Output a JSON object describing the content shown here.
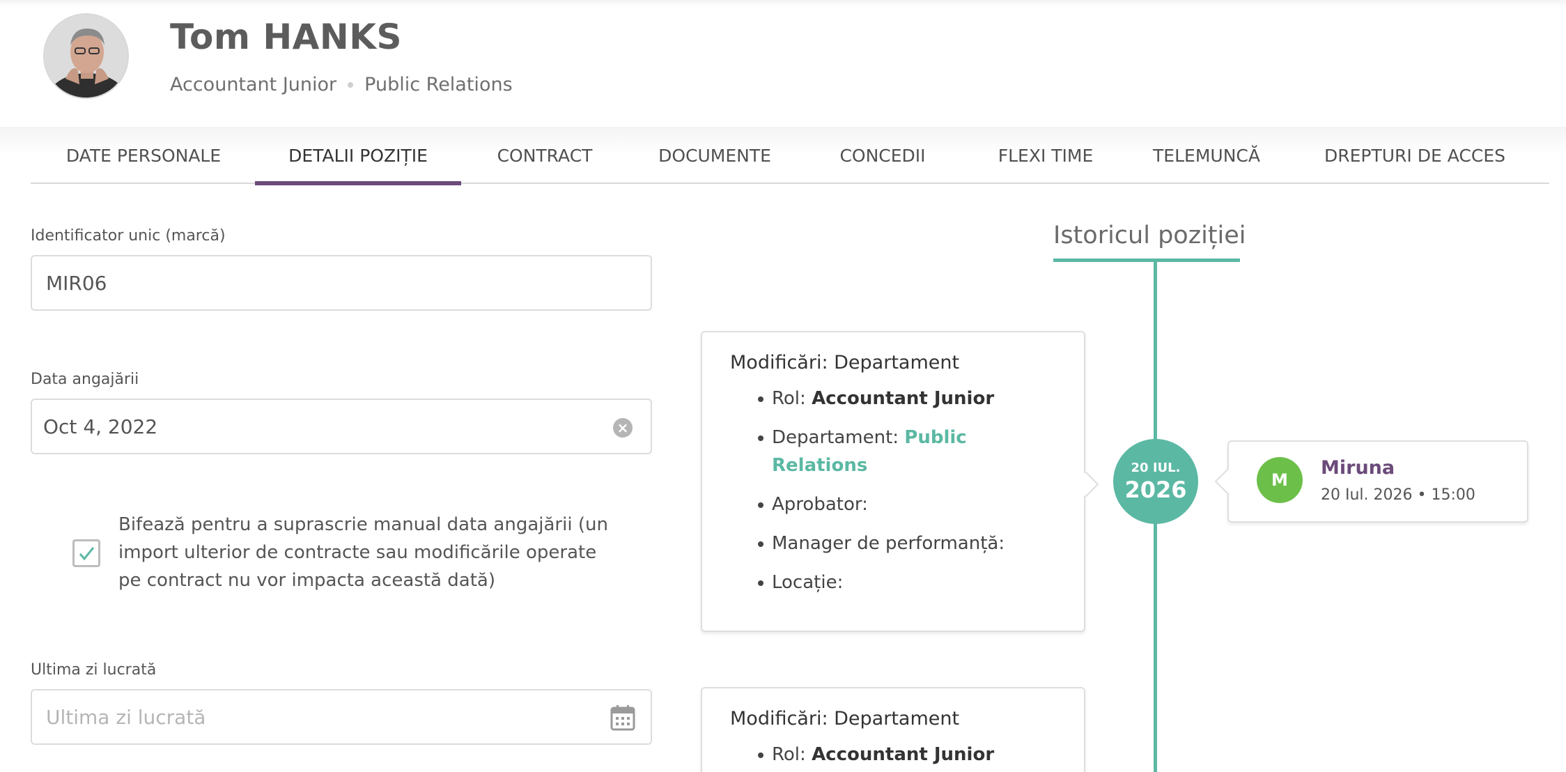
{
  "header": {
    "name": "Tom HANKS",
    "role": "Accountant Junior",
    "department": "Public Relations"
  },
  "tabs": [
    {
      "label": "DATE PERSONALE"
    },
    {
      "label": "DETALII POZIȚIE"
    },
    {
      "label": "CONTRACT"
    },
    {
      "label": "DOCUMENTE"
    },
    {
      "label": "CONCEDII"
    },
    {
      "label": "FLEXI TIME"
    },
    {
      "label": "TELEMUNCĂ"
    },
    {
      "label": "DREPTURI DE ACCES"
    }
  ],
  "active_tab": "DETALII POZIȚIE",
  "form": {
    "id_label": "Identificator unic (marcă)",
    "id_value": "MIR06",
    "hire_label": "Data angajării",
    "hire_value": "Oct 4, 2022",
    "override_text": "Bifează pentru a suprascrie manual data angajării (un import ulterior de contracte sau modificările operate pe contract nu vor impacta această dată)",
    "override_checked": true,
    "last_day_label": "Ultima zi lucrată",
    "last_day_placeholder": "Ultima zi lucrată"
  },
  "history": {
    "title": "Istoricul poziției",
    "entries": [
      {
        "title": "Modificări: Departament",
        "role_label": "Rol:",
        "role_value": "Accountant Junior",
        "dept_label": "Departament:",
        "dept_value": "Public Relations",
        "approver_label": "Aprobator:",
        "manager_label": "Manager de performanță:",
        "location_label": "Locație:",
        "date_day": "20 IUL.",
        "date_year": "2026",
        "author_initial": "M",
        "author_name": "Miruna",
        "author_time": "20 Iul. 2026 • 15:00"
      },
      {
        "title": "Modificări: Departament",
        "role_label": "Rol:",
        "role_value": "Accountant Junior"
      }
    ]
  },
  "colors": {
    "accent_purple": "#6b4b7a",
    "teal": "#5bb8a3",
    "avatar_green": "#6cc04a"
  }
}
